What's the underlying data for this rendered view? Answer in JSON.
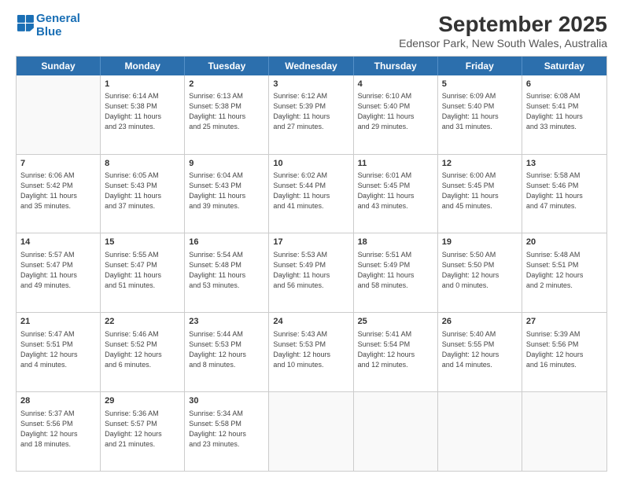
{
  "logo": {
    "line1": "General",
    "line2": "Blue"
  },
  "title": "September 2025",
  "subtitle": "Edensor Park, New South Wales, Australia",
  "days": [
    "Sunday",
    "Monday",
    "Tuesday",
    "Wednesday",
    "Thursday",
    "Friday",
    "Saturday"
  ],
  "weeks": [
    [
      {
        "day": "",
        "info": ""
      },
      {
        "day": "1",
        "info": "Sunrise: 6:14 AM\nSunset: 5:38 PM\nDaylight: 11 hours\nand 23 minutes."
      },
      {
        "day": "2",
        "info": "Sunrise: 6:13 AM\nSunset: 5:38 PM\nDaylight: 11 hours\nand 25 minutes."
      },
      {
        "day": "3",
        "info": "Sunrise: 6:12 AM\nSunset: 5:39 PM\nDaylight: 11 hours\nand 27 minutes."
      },
      {
        "day": "4",
        "info": "Sunrise: 6:10 AM\nSunset: 5:40 PM\nDaylight: 11 hours\nand 29 minutes."
      },
      {
        "day": "5",
        "info": "Sunrise: 6:09 AM\nSunset: 5:40 PM\nDaylight: 11 hours\nand 31 minutes."
      },
      {
        "day": "6",
        "info": "Sunrise: 6:08 AM\nSunset: 5:41 PM\nDaylight: 11 hours\nand 33 minutes."
      }
    ],
    [
      {
        "day": "7",
        "info": "Sunrise: 6:06 AM\nSunset: 5:42 PM\nDaylight: 11 hours\nand 35 minutes."
      },
      {
        "day": "8",
        "info": "Sunrise: 6:05 AM\nSunset: 5:43 PM\nDaylight: 11 hours\nand 37 minutes."
      },
      {
        "day": "9",
        "info": "Sunrise: 6:04 AM\nSunset: 5:43 PM\nDaylight: 11 hours\nand 39 minutes."
      },
      {
        "day": "10",
        "info": "Sunrise: 6:02 AM\nSunset: 5:44 PM\nDaylight: 11 hours\nand 41 minutes."
      },
      {
        "day": "11",
        "info": "Sunrise: 6:01 AM\nSunset: 5:45 PM\nDaylight: 11 hours\nand 43 minutes."
      },
      {
        "day": "12",
        "info": "Sunrise: 6:00 AM\nSunset: 5:45 PM\nDaylight: 11 hours\nand 45 minutes."
      },
      {
        "day": "13",
        "info": "Sunrise: 5:58 AM\nSunset: 5:46 PM\nDaylight: 11 hours\nand 47 minutes."
      }
    ],
    [
      {
        "day": "14",
        "info": "Sunrise: 5:57 AM\nSunset: 5:47 PM\nDaylight: 11 hours\nand 49 minutes."
      },
      {
        "day": "15",
        "info": "Sunrise: 5:55 AM\nSunset: 5:47 PM\nDaylight: 11 hours\nand 51 minutes."
      },
      {
        "day": "16",
        "info": "Sunrise: 5:54 AM\nSunset: 5:48 PM\nDaylight: 11 hours\nand 53 minutes."
      },
      {
        "day": "17",
        "info": "Sunrise: 5:53 AM\nSunset: 5:49 PM\nDaylight: 11 hours\nand 56 minutes."
      },
      {
        "day": "18",
        "info": "Sunrise: 5:51 AM\nSunset: 5:49 PM\nDaylight: 11 hours\nand 58 minutes."
      },
      {
        "day": "19",
        "info": "Sunrise: 5:50 AM\nSunset: 5:50 PM\nDaylight: 12 hours\nand 0 minutes."
      },
      {
        "day": "20",
        "info": "Sunrise: 5:48 AM\nSunset: 5:51 PM\nDaylight: 12 hours\nand 2 minutes."
      }
    ],
    [
      {
        "day": "21",
        "info": "Sunrise: 5:47 AM\nSunset: 5:51 PM\nDaylight: 12 hours\nand 4 minutes."
      },
      {
        "day": "22",
        "info": "Sunrise: 5:46 AM\nSunset: 5:52 PM\nDaylight: 12 hours\nand 6 minutes."
      },
      {
        "day": "23",
        "info": "Sunrise: 5:44 AM\nSunset: 5:53 PM\nDaylight: 12 hours\nand 8 minutes."
      },
      {
        "day": "24",
        "info": "Sunrise: 5:43 AM\nSunset: 5:53 PM\nDaylight: 12 hours\nand 10 minutes."
      },
      {
        "day": "25",
        "info": "Sunrise: 5:41 AM\nSunset: 5:54 PM\nDaylight: 12 hours\nand 12 minutes."
      },
      {
        "day": "26",
        "info": "Sunrise: 5:40 AM\nSunset: 5:55 PM\nDaylight: 12 hours\nand 14 minutes."
      },
      {
        "day": "27",
        "info": "Sunrise: 5:39 AM\nSunset: 5:56 PM\nDaylight: 12 hours\nand 16 minutes."
      }
    ],
    [
      {
        "day": "28",
        "info": "Sunrise: 5:37 AM\nSunset: 5:56 PM\nDaylight: 12 hours\nand 18 minutes."
      },
      {
        "day": "29",
        "info": "Sunrise: 5:36 AM\nSunset: 5:57 PM\nDaylight: 12 hours\nand 21 minutes."
      },
      {
        "day": "30",
        "info": "Sunrise: 5:34 AM\nSunset: 5:58 PM\nDaylight: 12 hours\nand 23 minutes."
      },
      {
        "day": "",
        "info": ""
      },
      {
        "day": "",
        "info": ""
      },
      {
        "day": "",
        "info": ""
      },
      {
        "day": "",
        "info": ""
      }
    ]
  ]
}
